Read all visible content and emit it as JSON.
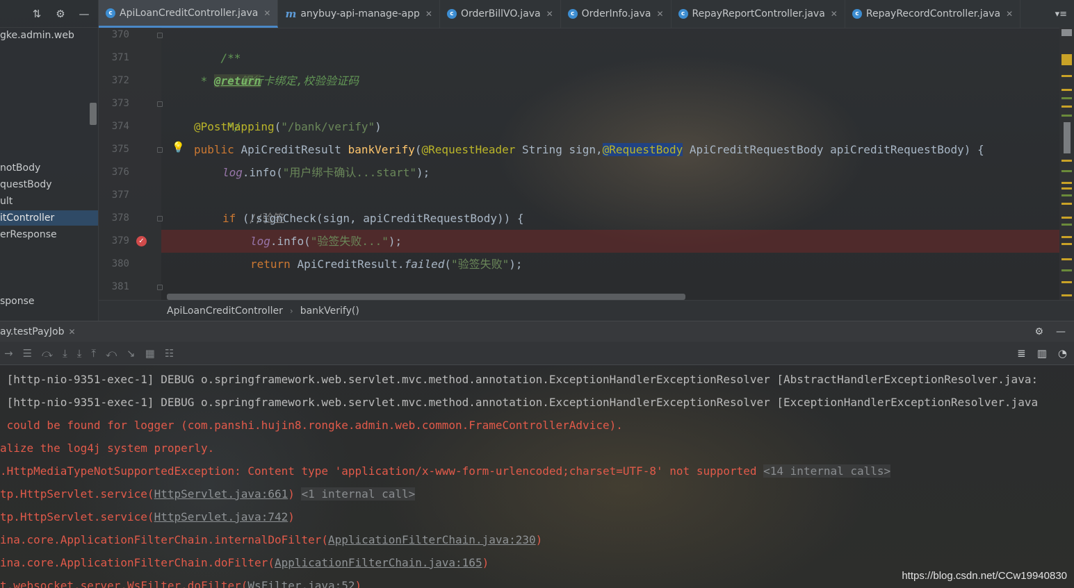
{
  "project": {
    "root_label": "gke.admin.web",
    "items": [
      {
        "label": "notBody",
        "selected": false
      },
      {
        "label": "questBody",
        "selected": false
      },
      {
        "label": "ult",
        "selected": false
      },
      {
        "label": "itController",
        "selected": true
      },
      {
        "label": "erResponse",
        "selected": false
      },
      {
        "label": "sponse",
        "selected": false
      }
    ]
  },
  "tabs": [
    {
      "label": "ApiLoanCreditController.java",
      "icon": "class-icon",
      "active": true
    },
    {
      "label": "anybuy-api-manage-app",
      "icon": "module-icon",
      "active": false
    },
    {
      "label": "OrderBillVO.java",
      "icon": "class-icon",
      "active": false
    },
    {
      "label": "OrderInfo.java",
      "icon": "class-icon",
      "active": false
    },
    {
      "label": "RepayReportController.java",
      "icon": "class-icon",
      "active": false
    },
    {
      "label": "RepayRecordController.java",
      "icon": "class-icon",
      "active": false
    }
  ],
  "tabs_menu_label": "▾≡",
  "editor": {
    "line_numbers": [
      "370",
      "371",
      "372",
      "373",
      "374",
      "375",
      "376",
      "377",
      "378",
      "379",
      "380",
      "381"
    ],
    "code": {
      "l370": "/**",
      "l371": " * 银行卡绑定,校验验证码",
      "l372_star": " * ",
      "l372_tag": "@return",
      "l373": " */",
      "l374_anno": "@PostMapping",
      "l374_open": "(",
      "l374_str": "\"/bank/verify\"",
      "l374_close": ")",
      "l375_kw": "public ",
      "l375_type": "ApiCreditResult ",
      "l375_fn": "bankVerify",
      "l375_p1": "(",
      "l375_anno1": "@RequestHeader",
      "l375_p2": " String sign,",
      "l375_anno2": "@RequestBody",
      "l375_p3": " ApiCreditRequestBody apiCreditRequestBody) {",
      "l376_field": "log",
      "l376_call": ".info(",
      "l376_str": "\"用户绑卡确认...start\"",
      "l376_end": ");",
      "l377": "//验签",
      "l378_kw": "if ",
      "l378_rest": "(!signCheck(sign, apiCreditRequestBody)) {",
      "l379_field": "log",
      "l379_call": ".info(",
      "l379_str": "\"验签失败...\"",
      "l379_end": ");",
      "l380_kw": "return ",
      "l380_cls": "ApiCreditResult.",
      "l380_fn": "failed",
      "l380_open": "(",
      "l380_str": "\"验签失败\"",
      "l380_end": ");",
      "l381": "}"
    }
  },
  "breadcrumb": [
    "ApiLoanCreditController",
    "bankVerify()"
  ],
  "run": {
    "tab_label": "ay.testPayJob",
    "console": {
      "line1": " [http-nio-9351-exec-1] DEBUG o.springframework.web.servlet.mvc.method.annotation.ExceptionHandlerExceptionResolver [AbstractHandlerExceptionResolver.java:",
      "line2": " [http-nio-9351-exec-1] DEBUG o.springframework.web.servlet.mvc.method.annotation.ExceptionHandlerExceptionResolver [ExceptionHandlerExceptionResolver.java",
      "line3": " could be found for logger (com.panshi.hujin8.rongke.admin.web.common.FrameControllerAdvice).",
      "line4": "alize the log4j system properly.",
      "line5_text": ".HttpMediaTypeNotSupportedException: Content type 'application/x-www-form-urlencoded;charset=UTF-8' not supported ",
      "line5_fold": "<14 internal calls>",
      "line6_text": "tp.HttpServlet.service(",
      "line6_link": "HttpServlet.java:661",
      "line6_end": ") ",
      "line6_fold": "<1 internal call>",
      "line7_text": "tp.HttpServlet.service(",
      "line7_link": "HttpServlet.java:742",
      "line7_end": ")",
      "line8_text": "ina.core.ApplicationFilterChain.internalDoFilter(",
      "line8_link": "ApplicationFilterChain.java:230",
      "line8_end": ")",
      "line9_text": "ina.core.ApplicationFilterChain.doFilter(",
      "line9_link": "ApplicationFilterChain.java:165",
      "line9_end": ")",
      "line10_text": "t.websocket.server.WsFilter.doFilter(",
      "line10_link": "WsFilter.java:52",
      "line10_end": ")"
    }
  },
  "watermark": "https://blog.csdn.net/CCw19940830",
  "colors": {
    "accent": "#4a88c7",
    "error": "#e25a4a",
    "breakpoint": "#d14b4b",
    "selection": "#2f4a66"
  }
}
